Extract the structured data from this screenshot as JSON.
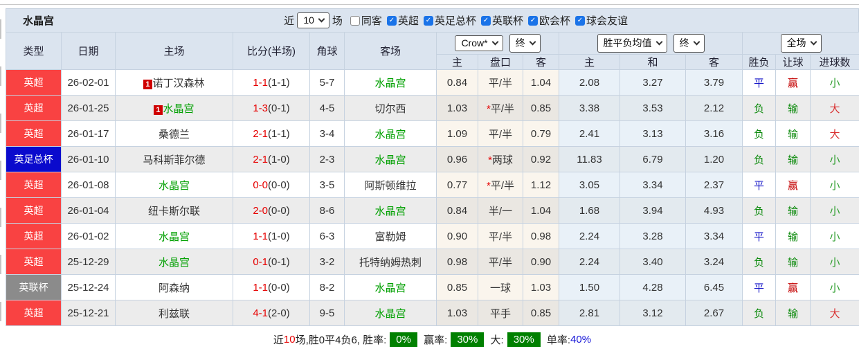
{
  "title": "水晶宫",
  "filters": {
    "recent_prefix": "近",
    "recent_value": "10",
    "recent_suffix": "场",
    "checkboxes": [
      {
        "label": "同客",
        "checked": false
      },
      {
        "label": "英超",
        "checked": true
      },
      {
        "label": "英足总杯",
        "checked": true
      },
      {
        "label": "英联杯",
        "checked": true
      },
      {
        "label": "欧会杯",
        "checked": true
      },
      {
        "label": "球会友谊",
        "checked": true
      }
    ]
  },
  "controls": {
    "odds_company": "Crow*",
    "odds_time": "终",
    "avg_type": "胜平负均值",
    "avg_time": "终",
    "scope": "全场"
  },
  "columns": {
    "type": "类型",
    "date": "日期",
    "home": "主场",
    "score": "比分(半场)",
    "corner": "角球",
    "away": "客场",
    "sub": [
      "主",
      "盘口",
      "客",
      "主",
      "和",
      "客",
      "胜负",
      "让球",
      "进球数"
    ]
  },
  "type_colors": {
    "英超": "#f94242",
    "英足总杯": "#0a0acd",
    "英联杯": "#8b8b8b"
  },
  "value_colors": {
    "平": "#1515c8",
    "负": "#0b8a0b",
    "赢": "#c40000",
    "输": "#0b8a0b",
    "大": "#d93030",
    "小": "#2e9e2e"
  },
  "rows": [
    {
      "type": "英超",
      "date": "26-02-01",
      "home": "诺丁汉森林",
      "home_green": false,
      "home_card": "1",
      "score": "1-1",
      "half": "(1-1)",
      "corner": "5-7",
      "away": "水晶宫",
      "away_green": true,
      "odds": [
        "0.84",
        "平/半",
        "1.04"
      ],
      "avg": [
        "2.08",
        "3.27",
        "3.79"
      ],
      "result": "平",
      "hresult": "赢",
      "goals": "小"
    },
    {
      "type": "英超",
      "date": "26-01-25",
      "home": "水晶宫",
      "home_green": true,
      "home_card": "1",
      "score": "1-3",
      "half": "(0-1)",
      "corner": "4-5",
      "away": "切尔西",
      "away_green": false,
      "odds": [
        "1.03",
        "*平/半",
        "0.85"
      ],
      "avg": [
        "3.38",
        "3.53",
        "2.12"
      ],
      "result": "负",
      "hresult": "输",
      "goals": "大"
    },
    {
      "type": "英超",
      "date": "26-01-17",
      "home": "桑德兰",
      "home_green": false,
      "home_card": null,
      "score": "2-1",
      "half": "(1-1)",
      "corner": "3-4",
      "away": "水晶宫",
      "away_green": true,
      "odds": [
        "1.09",
        "平/半",
        "0.79"
      ],
      "avg": [
        "2.41",
        "3.13",
        "3.16"
      ],
      "result": "负",
      "hresult": "输",
      "goals": "大"
    },
    {
      "type": "英足总杯",
      "date": "26-01-10",
      "home": "马科斯菲尔德",
      "home_green": false,
      "home_card": null,
      "score": "2-1",
      "half": "(1-0)",
      "corner": "2-3",
      "away": "水晶宫",
      "away_green": true,
      "odds": [
        "0.96",
        "*两球",
        "0.92"
      ],
      "avg": [
        "11.83",
        "6.79",
        "1.20"
      ],
      "result": "负",
      "hresult": "输",
      "goals": "小"
    },
    {
      "type": "英超",
      "date": "26-01-08",
      "home": "水晶宫",
      "home_green": true,
      "home_card": null,
      "score": "0-0",
      "half": "(0-0)",
      "corner": "3-5",
      "away": "阿斯顿维拉",
      "away_green": false,
      "odds": [
        "0.77",
        "*平/半",
        "1.12"
      ],
      "avg": [
        "3.05",
        "3.34",
        "2.37"
      ],
      "result": "平",
      "hresult": "赢",
      "goals": "小"
    },
    {
      "type": "英超",
      "date": "26-01-04",
      "home": "纽卡斯尔联",
      "home_green": false,
      "home_card": null,
      "score": "2-0",
      "half": "(0-0)",
      "corner": "8-6",
      "away": "水晶宫",
      "away_green": true,
      "odds": [
        "0.84",
        "半/一",
        "1.04"
      ],
      "avg": [
        "1.68",
        "3.94",
        "4.93"
      ],
      "result": "负",
      "hresult": "输",
      "goals": "小"
    },
    {
      "type": "英超",
      "date": "26-01-02",
      "home": "水晶宫",
      "home_green": true,
      "home_card": null,
      "score": "1-1",
      "half": "(1-0)",
      "corner": "6-3",
      "away": "富勒姆",
      "away_green": false,
      "odds": [
        "0.90",
        "平/半",
        "0.98"
      ],
      "avg": [
        "2.24",
        "3.28",
        "3.34"
      ],
      "result": "平",
      "hresult": "输",
      "goals": "小"
    },
    {
      "type": "英超",
      "date": "25-12-29",
      "home": "水晶宫",
      "home_green": true,
      "home_card": null,
      "score": "0-1",
      "half": "(0-1)",
      "corner": "3-2",
      "away": "托特纳姆热刺",
      "away_green": false,
      "odds": [
        "0.98",
        "平/半",
        "0.90"
      ],
      "avg": [
        "2.24",
        "3.40",
        "3.24"
      ],
      "result": "负",
      "hresult": "输",
      "goals": "小"
    },
    {
      "type": "英联杯",
      "date": "25-12-24",
      "home": "阿森纳",
      "home_green": false,
      "home_card": null,
      "score": "1-1",
      "half": "(0-0)",
      "corner": "8-2",
      "away": "水晶宫",
      "away_green": true,
      "odds": [
        "0.85",
        "一球",
        "1.03"
      ],
      "avg": [
        "1.50",
        "4.28",
        "6.45"
      ],
      "result": "平",
      "hresult": "赢",
      "goals": "小"
    },
    {
      "type": "英超",
      "date": "25-12-21",
      "home": "利兹联",
      "home_green": false,
      "home_card": null,
      "score": "4-1",
      "half": "(2-0)",
      "corner": "9-5",
      "away": "水晶宫",
      "away_green": true,
      "odds": [
        "1.03",
        "平手",
        "0.85"
      ],
      "avg": [
        "2.81",
        "3.12",
        "2.67"
      ],
      "result": "负",
      "hresult": "输",
      "goals": "大"
    }
  ],
  "summary": {
    "near": "近",
    "games": "10",
    "record": "场,胜0平4负6, 胜率:",
    "win_rate": "0%",
    "handicap_label": "赢率:",
    "handicap_rate": "30%",
    "big_label": "大:",
    "big_rate": "30%",
    "single_label": "单率:",
    "single_rate": "40%"
  }
}
